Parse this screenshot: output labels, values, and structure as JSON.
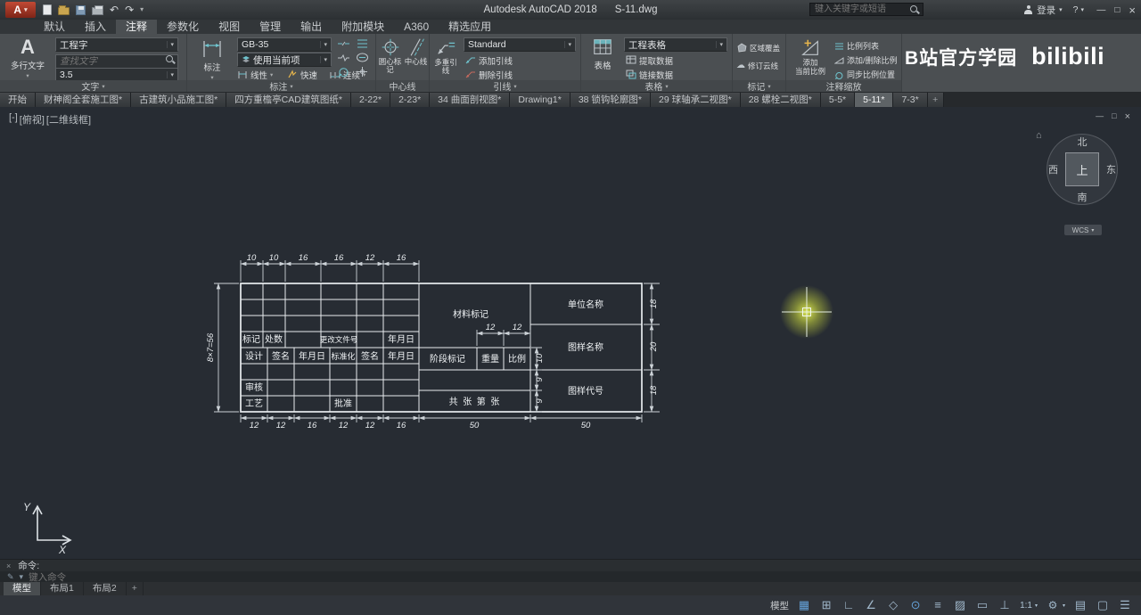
{
  "titlebar": {
    "app_title": "Autodesk AutoCAD 2018",
    "doc_title": "S-11.dwg",
    "search_placeholder": "键入关键字或短语",
    "signin_label": "登录"
  },
  "menubar": {
    "tabs": [
      "默认",
      "插入",
      "注释",
      "参数化",
      "视图",
      "管理",
      "输出",
      "附加模块",
      "A360",
      "精选应用"
    ]
  },
  "ribbon": {
    "text_panel": {
      "label": "文字",
      "mtext": "多行文字",
      "style": "工程字",
      "find_placeholder": "查找文字",
      "height": "3.5"
    },
    "dim_panel": {
      "label": "标注",
      "dim": "标注",
      "style": "GB-35",
      "layer": "使用当前项",
      "linear": "线性",
      "quick": "快速",
      "cont": "连续"
    },
    "center_panel": {
      "label": "中心线",
      "mark": "圆心标记",
      "line": "中心线"
    },
    "leader_panel": {
      "label": "引线",
      "style": "Standard",
      "multi": "多重引线",
      "add": "添加引线",
      "remove": "删除引线"
    },
    "table_panel": {
      "label": "表格",
      "table": "表格",
      "style": "工程表格",
      "extract": "提取数据",
      "link": "链接数据"
    },
    "markup_panel": {
      "label": "标记",
      "wipeout": "区域覆盖",
      "revcloud": "修订云线"
    },
    "scale_panel": {
      "label": "注释缩放",
      "add1": "添加",
      "add2": "当前比例",
      "list": "比例列表",
      "adddel": "添加/删除比例",
      "sync": "同步比例位置"
    },
    "watermark": "B站官方学园",
    "watermark_logo": "bilibili"
  },
  "file_tabs": [
    "开始",
    "财神阁全套施工图*",
    "古建筑小品施工图*",
    "四方重檐亭CAD建筑图纸*",
    "2-22*",
    "2-23*",
    "34 曲面剖视图*",
    "Drawing1*",
    "38 锁钩轮廓图*",
    "29 球轴承二视图*",
    "28 螺栓二视图*",
    "5-5*",
    "5-11*",
    "7-3*"
  ],
  "viewport": {
    "vp_control": "[-]",
    "view_control": "[俯视]",
    "style_control": "[二维线框]",
    "viewcube": {
      "north": "北",
      "south": "南",
      "east": "东",
      "west": "西",
      "top": "上",
      "wcs": "WCS"
    }
  },
  "drawing": {
    "dims": {
      "top": [
        "10",
        "10",
        "16",
        "16",
        "12",
        "16"
      ],
      "bottom": [
        "12",
        "12",
        "16",
        "12",
        "12",
        "16"
      ],
      "spans": [
        "50",
        "50"
      ],
      "left": "8×7=56",
      "right": [
        "18",
        "20",
        "18"
      ],
      "material": [
        "12",
        "12"
      ],
      "stage": [
        "10",
        "9",
        "9"
      ]
    },
    "cells": {
      "mark": "标记",
      "count": "处数",
      "change_no": "更改文件号",
      "date": "年月日",
      "design": "设计",
      "sign": "签名",
      "standard": "标准化",
      "review": "审核",
      "process": "工艺",
      "approve": "批准",
      "material": "材料标记",
      "stage": "阶段标记",
      "weight": "重量",
      "scale": "比例",
      "sheets": "共  张  第  张",
      "company": "单位名称",
      "title": "图样名称",
      "number": "图样代号"
    }
  },
  "command": {
    "history": "命令:",
    "placeholder": "键入命令"
  },
  "layout_tabs": {
    "model": "模型",
    "layout1": "布局1",
    "layout2": "布局2",
    "add": "+"
  },
  "statusbar": {
    "model": "模型",
    "scale": "1:1",
    "icons": [
      "▦",
      "⊞",
      "∟",
      "∠",
      "◇",
      "⊙",
      "≡",
      "▨",
      "▭",
      "⊥",
      "▤",
      "▢",
      "☰"
    ]
  },
  "glyphs": {
    "dropdown": "▾",
    "undo": "↶",
    "redo": "↷",
    "minimize": "—",
    "maximize": "□",
    "close": "×",
    "help": "?",
    "gear": "⚙",
    "cloud": "☁",
    "mtext": "A",
    "home": "⌂",
    "pencil": "✎"
  }
}
